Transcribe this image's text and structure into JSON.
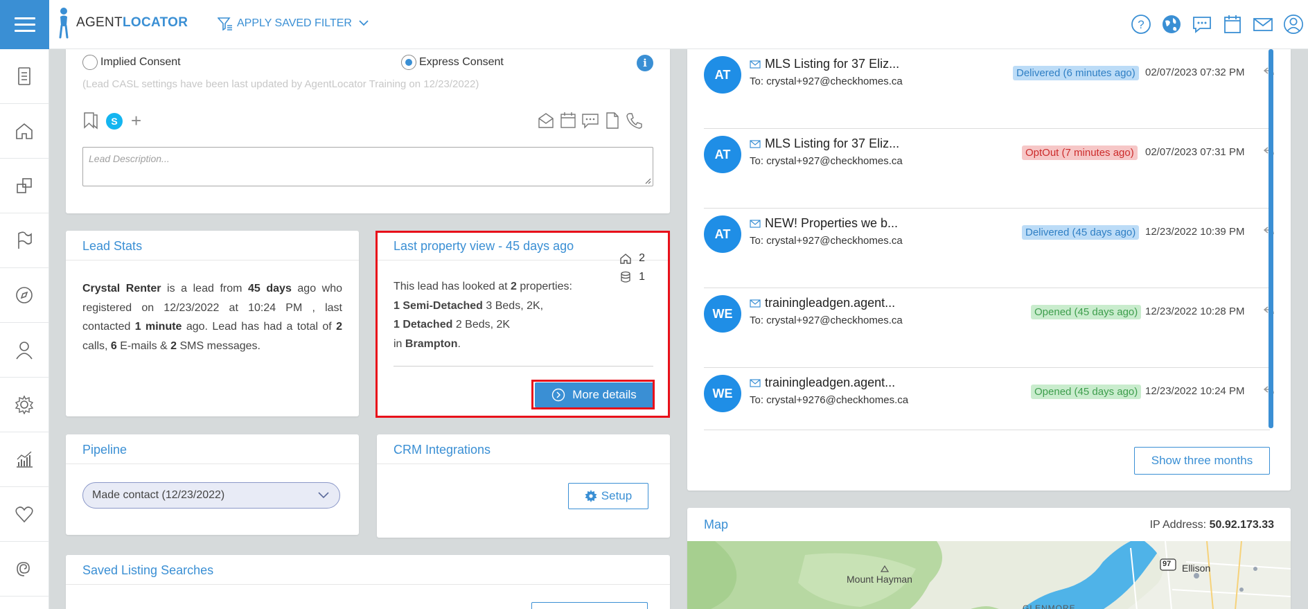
{
  "header": {
    "logo_prefix": "AGENT",
    "logo_suffix": "LOCATOR",
    "filter_label": "APPLY SAVED FILTER",
    "icons": [
      "help-icon",
      "globe-icon",
      "chat-icon",
      "calendar-icon",
      "mail-icon",
      "user-icon"
    ]
  },
  "sidebar": {
    "icons": [
      "document-icon",
      "home-icon",
      "duplicate-icon",
      "flag-icon",
      "compass-icon",
      "person-icon",
      "settings-icon",
      "analytics-icon",
      "heart-icon",
      "spiral-icon"
    ]
  },
  "consent": {
    "implied_label": "Implied Consent",
    "express_label": "Express Consent",
    "selected": "express",
    "casl_note": "(Lead CASL settings have been last updated by AgentLocator Training on 12/23/2022)",
    "skype_letter": "S",
    "plus_label": "+",
    "description_placeholder": "Lead Description..."
  },
  "lead_stats": {
    "title": "Lead Stats",
    "name": "Crystal Renter",
    "t1": " is a lead from ",
    "days": "45 days",
    "t2": " ago who registered on 12/23/2022 at 10:24 PM , last contacted ",
    "last_contacted": "1 minute",
    "t3": " ago. Lead has had a total of ",
    "calls": "2",
    "t4": " calls, ",
    "emails": "6",
    "t5": " E-mails & ",
    "sms": "2",
    "t6": " SMS messages."
  },
  "last_property": {
    "title": "Last property view - 45 days ago",
    "intro": "This lead has looked at ",
    "count": "2",
    "intro_end": " properties:",
    "semi_label": "1 Semi-Detached",
    "semi_detail": " 3 Beds, 2K,",
    "det_label": "1 Detached",
    "det_detail": " 2 Beds, 2K",
    "in_prefix": "in ",
    "city": "Brampton",
    "city_end": ".",
    "home_count": "2",
    "db_count": "1",
    "more_button": "More details"
  },
  "pipeline": {
    "title": "Pipeline",
    "selected": "Made contact (12/23/2022)"
  },
  "crm": {
    "title": "CRM Integrations",
    "setup_button": "Setup"
  },
  "saved_searches": {
    "title": "Saved Listing Searches"
  },
  "messages": [
    {
      "initials": "AT",
      "subject": "MLS Listing for 37 Eliz...",
      "to": "To: crystal+927@checkhomes.ca",
      "status": "Delivered (6 minutes ago)",
      "status_type": "delivered",
      "date": "02/07/2023  07:32 PM"
    },
    {
      "initials": "AT",
      "subject": "MLS Listing for 37 Eliz...",
      "to": "To: crystal+927@checkhomes.ca",
      "status": "OptOut (7 minutes ago)",
      "status_type": "optout",
      "date": "02/07/2023  07:31 PM"
    },
    {
      "initials": "AT",
      "subject": "NEW! Properties we b...",
      "to": "To: crystal+927@checkhomes.ca",
      "status": "Delivered (45 days ago)",
      "status_type": "delivered",
      "date": "12/23/2022  10:39 PM"
    },
    {
      "initials": "WE",
      "subject": "trainingleadgen.agent...",
      "to": "To: crystal+927@checkhomes.ca",
      "status": "Opened (45 days ago)",
      "status_type": "opened",
      "date": "12/23/2022  10:28 PM"
    },
    {
      "initials": "WE",
      "subject": "trainingleadgen.agent...",
      "to": "To: crystal+9276@checkhomes.ca",
      "status": "Opened (45 days ago)",
      "status_type": "opened",
      "date": "12/23/2022  10:24 PM"
    }
  ],
  "show_button": "Show three months",
  "map": {
    "title": "Map",
    "ip_label": "IP Address: ",
    "ip_value": "50.92.173.33",
    "place1": "Mount Hayman",
    "place2": "Ellison",
    "place3": "GLENMORE",
    "highway": "97"
  },
  "colors": {
    "accent": "#3a8fd4",
    "highlight": "#e8101a",
    "avatar": "#1f8ee6"
  }
}
